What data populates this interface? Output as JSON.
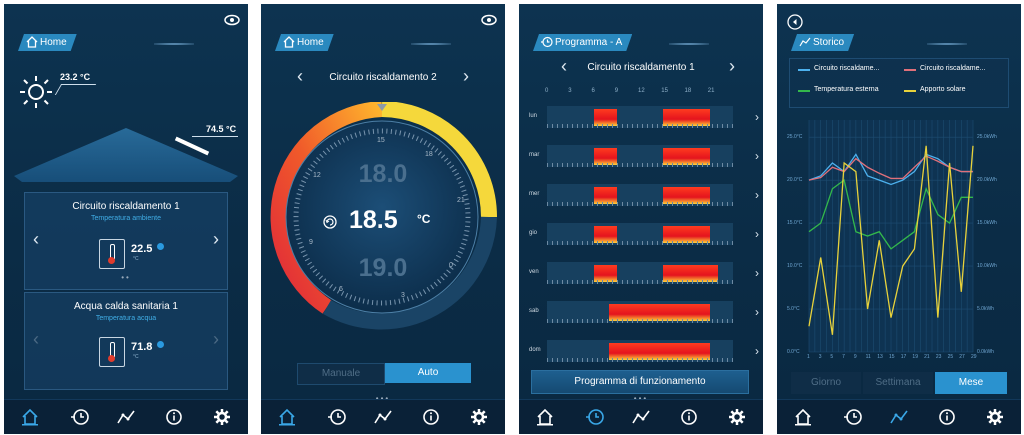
{
  "screen1": {
    "header": "Home",
    "outdoor_temp": "23.2 °C",
    "solar_temp": "74.5 °C",
    "card1": {
      "title": "Circuito riscaldamento 1",
      "subtitle": "Temperatura ambiente",
      "value": "22.5",
      "unit": "°C"
    },
    "card2": {
      "title": "Acqua calda sanitaria 1",
      "subtitle": "Temperatura acqua",
      "value": "71.8",
      "unit": "°C"
    },
    "nav": [
      "home-icon",
      "clock-icon",
      "chart-icon",
      "info-icon",
      "gear-icon"
    ]
  },
  "screen2": {
    "header": "Home",
    "circuit": "Circuito riscaldamento 2",
    "temp_upper": "18.0",
    "temp_current": "18.5",
    "temp_unit": "°C",
    "temp_lower": "19.0",
    "dial_ticks": [
      "15",
      "18",
      "21",
      "0",
      "3",
      "6",
      "9",
      "12"
    ],
    "mode_manual": "Manuale",
    "mode_auto": "Auto"
  },
  "screen3": {
    "header": "Programma - A",
    "circuit": "Circuito riscaldamento 1",
    "hours": [
      "0",
      "3",
      "6",
      "9",
      "12",
      "15",
      "18",
      "21"
    ],
    "days": [
      {
        "label": "lun",
        "bars": [
          [
            6,
            9
          ],
          [
            15,
            21
          ]
        ]
      },
      {
        "label": "mar",
        "bars": [
          [
            6,
            9
          ],
          [
            15,
            21
          ]
        ]
      },
      {
        "label": "mer",
        "bars": [
          [
            6,
            9
          ],
          [
            15,
            21
          ]
        ]
      },
      {
        "label": "gio",
        "bars": [
          [
            6,
            9
          ],
          [
            15,
            21
          ]
        ]
      },
      {
        "label": "ven",
        "bars": [
          [
            6,
            9
          ],
          [
            15,
            22
          ]
        ]
      },
      {
        "label": "sab",
        "bars": [
          [
            8,
            21
          ]
        ]
      },
      {
        "label": "dom",
        "bars": [
          [
            8,
            21
          ]
        ]
      }
    ],
    "button": "Programma di funzionamento"
  },
  "screen4": {
    "header": "Storico",
    "legend": [
      {
        "name": "Circuito riscaldame...",
        "color": "#4db1ee"
      },
      {
        "name": "Circuito riscaldame...",
        "color": "#e0707a"
      },
      {
        "name": "Temperatura esterna",
        "color": "#33b84b"
      },
      {
        "name": "Apporto solare",
        "color": "#e8d23b"
      }
    ],
    "tabs": [
      "Giorno",
      "Settimana",
      "Mese"
    ],
    "active_tab": "Mese"
  },
  "chart_data": {
    "type": "line",
    "x": [
      1,
      3,
      5,
      7,
      9,
      11,
      13,
      15,
      17,
      19,
      21,
      23,
      25,
      27,
      29
    ],
    "x_ticks": [
      "1",
      "3",
      "5",
      "7",
      "9",
      "11",
      "13",
      "15",
      "17",
      "19",
      "21",
      "23",
      "25",
      "27",
      "29"
    ],
    "y_left_ticks": [
      "0.0°C",
      "5.0°C",
      "10.0°C",
      "15.0°C",
      "20.0°C",
      "25.0°C"
    ],
    "y_right_ticks": [
      "0.0kWh",
      "5.0kWh",
      "10.0kWh",
      "15.0kWh",
      "20.0kWh",
      "25.0kWh"
    ],
    "ylim": [
      0,
      27
    ],
    "series": [
      {
        "name": "Circuito riscaldame...",
        "color": "#4db1ee",
        "values": [
          20,
          20.5,
          22,
          21,
          23,
          20.5,
          20,
          19.5,
          20,
          21,
          23,
          22.5,
          21.5,
          21,
          21
        ]
      },
      {
        "name": "Circuito riscaldame...",
        "color": "#e0707a",
        "values": [
          20,
          20.3,
          21.5,
          21,
          22.5,
          21.5,
          20.8,
          20.2,
          20.2,
          21.5,
          22.8,
          22.2,
          21.5,
          21,
          21
        ]
      },
      {
        "name": "Temperatura esterna",
        "color": "#33b84b",
        "values": [
          14,
          15,
          19,
          20,
          14,
          13.5,
          14,
          12,
          13,
          14,
          19,
          16,
          15,
          18,
          18
        ]
      },
      {
        "name": "Apporto solare",
        "color": "#e8d23b",
        "values": [
          3,
          11,
          2,
          22,
          21,
          5,
          13,
          4,
          10,
          12,
          24,
          4,
          22,
          7,
          24
        ]
      }
    ]
  }
}
